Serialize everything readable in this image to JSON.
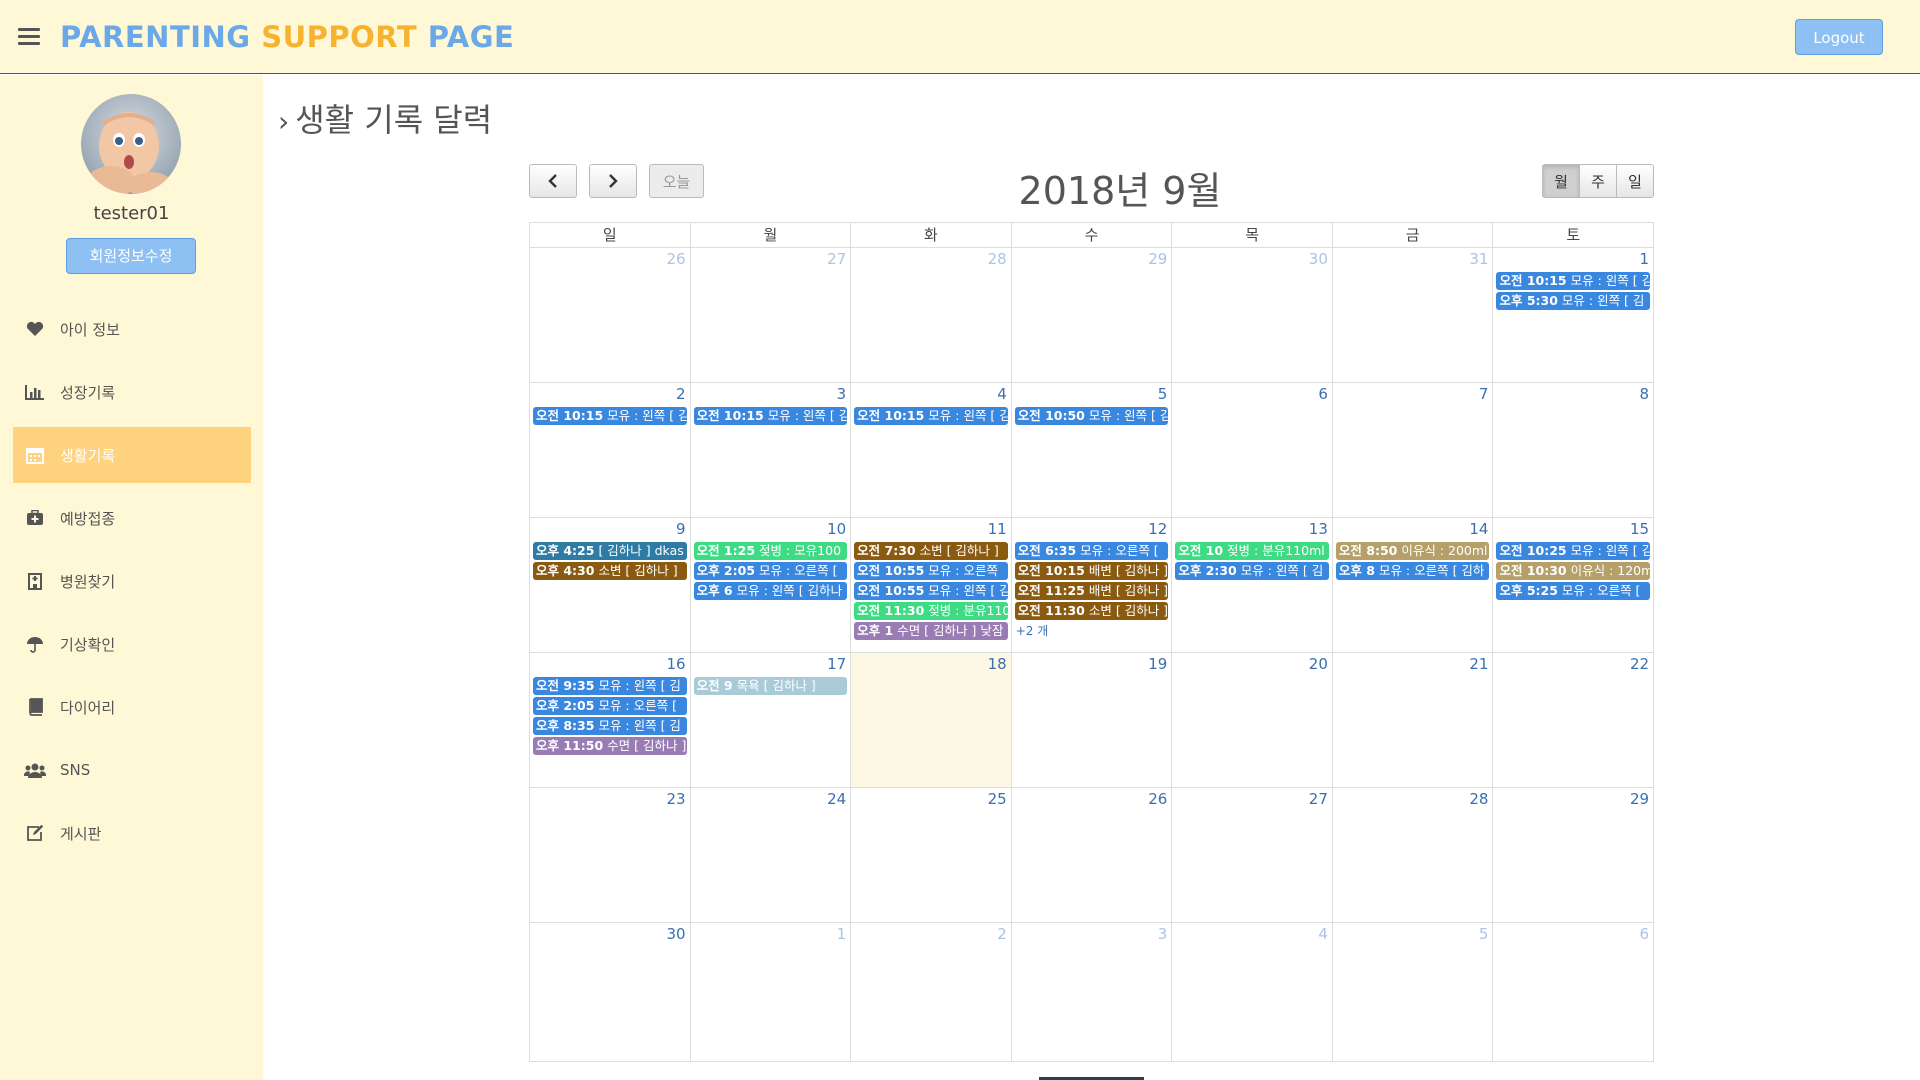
{
  "header": {
    "brand_part1": "PARENTING",
    "brand_part2": "SUPPORT",
    "brand_part3": "PAGE",
    "logout_label": "Logout"
  },
  "sidebar": {
    "username": "tester01",
    "edit_profile_label": "회원정보수정",
    "items": [
      {
        "label": "아이 정보",
        "icon": "heart-icon"
      },
      {
        "label": "성장기록",
        "icon": "bar-chart-icon"
      },
      {
        "label": "생활기록",
        "icon": "calendar-icon",
        "active": true
      },
      {
        "label": "예방접종",
        "icon": "medkit-icon"
      },
      {
        "label": "병원찾기",
        "icon": "hospital-icon"
      },
      {
        "label": "기상확인",
        "icon": "umbrella-icon"
      },
      {
        "label": "다이어리",
        "icon": "book-icon"
      },
      {
        "label": "SNS",
        "icon": "users-icon"
      },
      {
        "label": "게시판",
        "icon": "edit-icon"
      }
    ]
  },
  "page": {
    "title": "생활 기록 달력"
  },
  "calendar": {
    "title": "2018년 9월",
    "today_label": "오늘",
    "views": [
      "월",
      "주",
      "일"
    ],
    "active_view": "월",
    "weekdays": [
      "일",
      "월",
      "화",
      "수",
      "목",
      "금",
      "토"
    ],
    "colors": {
      "feeding": "#3a87e0",
      "bottle": "#3ddc84",
      "diaper": "#8a5a10",
      "sleep": "#9a7cb4",
      "solid_food": "#b5a06a",
      "note": "#2e7ca6",
      "bath": "#a9cbd8"
    },
    "weeks": [
      [
        {
          "d": "26",
          "other": true,
          "events": []
        },
        {
          "d": "27",
          "other": true,
          "events": []
        },
        {
          "d": "28",
          "other": true,
          "events": []
        },
        {
          "d": "29",
          "other": true,
          "events": []
        },
        {
          "d": "30",
          "other": true,
          "events": []
        },
        {
          "d": "31",
          "other": true,
          "events": []
        },
        {
          "d": "1",
          "events": [
            {
              "time": "오전 10:15",
              "text": "모유 : 왼쪽 [ 김",
              "type": "feeding"
            },
            {
              "time": "오후 5:30",
              "text": "모유 : 왼쪽 [ 김",
              "type": "feeding"
            }
          ]
        }
      ],
      [
        {
          "d": "2",
          "events": [
            {
              "time": "오전 10:15",
              "text": "모유 : 왼쪽 [ 김",
              "type": "feeding"
            }
          ]
        },
        {
          "d": "3",
          "events": [
            {
              "time": "오전 10:15",
              "text": "모유 : 왼쪽 [ 김",
              "type": "feeding"
            }
          ]
        },
        {
          "d": "4",
          "events": [
            {
              "time": "오전 10:15",
              "text": "모유 : 왼쪽 [ 김",
              "type": "feeding"
            }
          ]
        },
        {
          "d": "5",
          "events": [
            {
              "time": "오전 10:50",
              "text": "모유 : 왼쪽 [ 김",
              "type": "feeding"
            }
          ]
        },
        {
          "d": "6",
          "events": []
        },
        {
          "d": "7",
          "events": []
        },
        {
          "d": "8",
          "events": []
        }
      ],
      [
        {
          "d": "9",
          "events": [
            {
              "time": "오후 4:25",
              "text": "[ 김하나 ] dkas",
              "type": "note"
            },
            {
              "time": "오후 4:30",
              "text": "소변 [ 김하나 ]",
              "type": "diaper"
            }
          ]
        },
        {
          "d": "10",
          "events": [
            {
              "time": "오전 1:25",
              "text": "젖병 : 모유100",
              "type": "bottle"
            },
            {
              "time": "오후 2:05",
              "text": "모유 : 오른쪽 [",
              "type": "feeding"
            },
            {
              "time": "오후 6",
              "text": "모유 : 왼쪽 [ 김하나",
              "type": "feeding"
            }
          ]
        },
        {
          "d": "11",
          "events": [
            {
              "time": "오전 7:30",
              "text": "소변 [ 김하나 ]",
              "type": "diaper"
            },
            {
              "time": "오전 10:55",
              "text": "모유 : 오른쪽",
              "type": "feeding"
            },
            {
              "time": "오전 10:55",
              "text": "모유 : 왼쪽 [ 김",
              "type": "feeding"
            },
            {
              "time": "오전 11:30",
              "text": "젖병 : 분유110",
              "type": "bottle"
            },
            {
              "time": "오후 1",
              "text": "수면 [ 김하나 ] 낮잠",
              "type": "sleep"
            }
          ]
        },
        {
          "d": "12",
          "events": [
            {
              "time": "오전 6:35",
              "text": "모유 : 오른쪽 [",
              "type": "feeding"
            },
            {
              "time": "오전 10:15",
              "text": "배변 [ 김하나 ]",
              "type": "diaper"
            },
            {
              "time": "오전 11:25",
              "text": "배변 [ 김하나 ]",
              "type": "diaper"
            },
            {
              "time": "오전 11:30",
              "text": "소변 [ 김하나 ]",
              "type": "diaper"
            }
          ],
          "more": "+2 개"
        },
        {
          "d": "13",
          "events": [
            {
              "time": "오전 10",
              "text": "젖병 : 분유110ml",
              "type": "bottle"
            },
            {
              "time": "오후 2:30",
              "text": "모유 : 왼쪽 [ 김",
              "type": "feeding"
            }
          ]
        },
        {
          "d": "14",
          "events": [
            {
              "time": "오전 8:50",
              "text": "이유식 : 200ml",
              "type": "solid_food"
            },
            {
              "time": "오후 8",
              "text": "모유 : 오른쪽 [ 김하",
              "type": "feeding"
            }
          ]
        },
        {
          "d": "15",
          "events": [
            {
              "time": "오전 10:25",
              "text": "모유 : 왼쪽 [ 김",
              "type": "feeding"
            },
            {
              "time": "오전 10:30",
              "text": "이유식 : 120ml",
              "type": "solid_food"
            },
            {
              "time": "오후 5:25",
              "text": "모유 : 오른쪽 [",
              "type": "feeding"
            }
          ]
        }
      ],
      [
        {
          "d": "16",
          "events": [
            {
              "time": "오전 9:35",
              "text": "모유 : 왼쪽 [ 김",
              "type": "feeding"
            },
            {
              "time": "오후 2:05",
              "text": "모유 : 오른쪽 [",
              "type": "feeding"
            },
            {
              "time": "오후 8:35",
              "text": "모유 : 왼쪽 [ 김",
              "type": "feeding"
            },
            {
              "time": "오후 11:50",
              "text": "수면 [ 김하나 ]",
              "type": "sleep"
            }
          ]
        },
        {
          "d": "17",
          "events": [
            {
              "time": "오전 9",
              "text": "목욕 [ 김하나 ]",
              "type": "bath"
            }
          ]
        },
        {
          "d": "18",
          "today": true,
          "events": []
        },
        {
          "d": "19",
          "events": []
        },
        {
          "d": "20",
          "events": []
        },
        {
          "d": "21",
          "events": []
        },
        {
          "d": "22",
          "events": []
        }
      ],
      [
        {
          "d": "23",
          "events": []
        },
        {
          "d": "24",
          "events": []
        },
        {
          "d": "25",
          "events": []
        },
        {
          "d": "26",
          "events": []
        },
        {
          "d": "27",
          "events": []
        },
        {
          "d": "28",
          "events": []
        },
        {
          "d": "29",
          "events": []
        }
      ],
      [
        {
          "d": "30",
          "events": []
        },
        {
          "d": "1",
          "other": true,
          "events": []
        },
        {
          "d": "2",
          "other": true,
          "events": []
        },
        {
          "d": "3",
          "other": true,
          "events": []
        },
        {
          "d": "4",
          "other": true,
          "events": []
        },
        {
          "d": "5",
          "other": true,
          "events": []
        },
        {
          "d": "6",
          "other": true,
          "events": []
        }
      ]
    ]
  }
}
